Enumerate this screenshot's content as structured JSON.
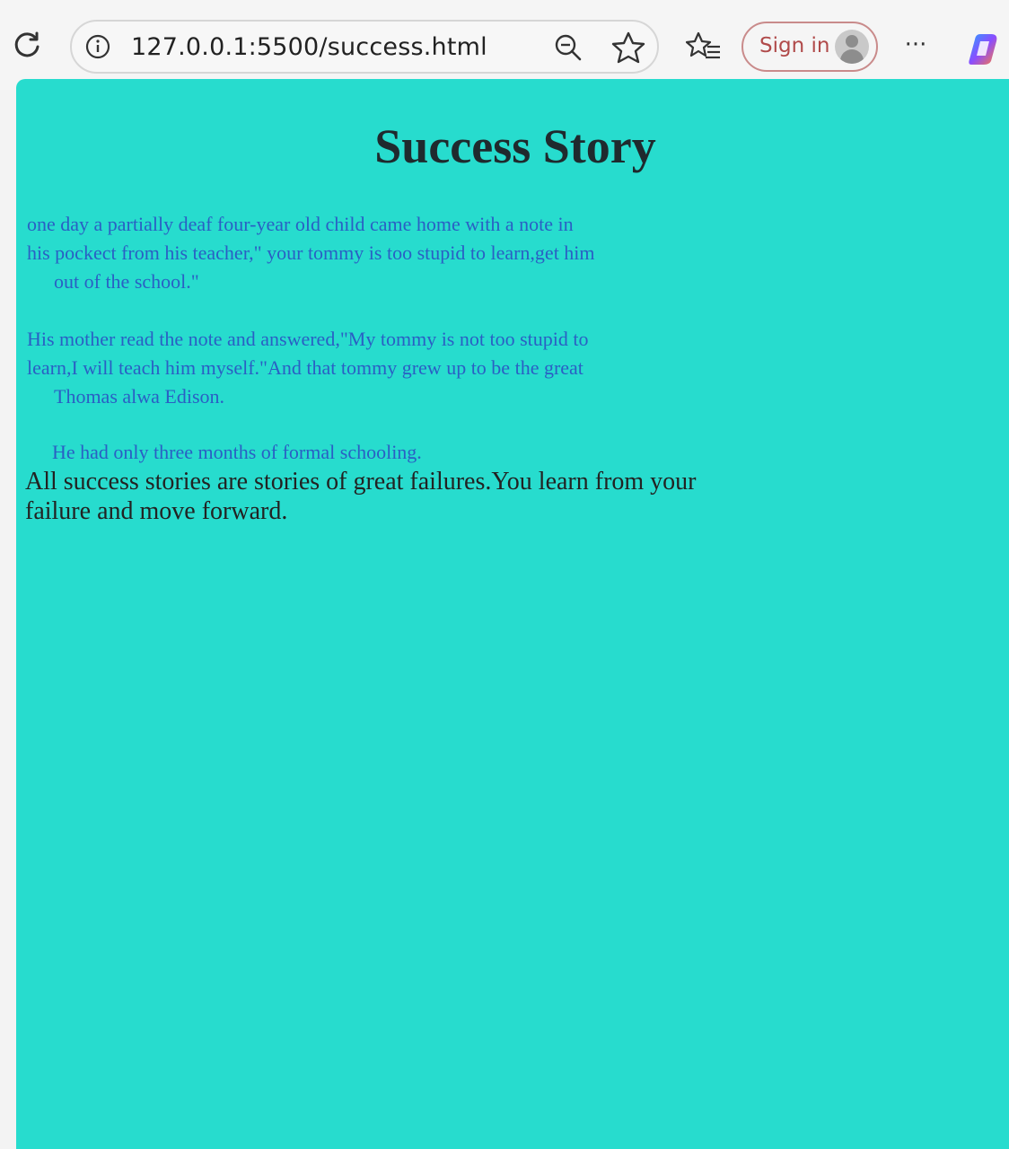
{
  "browser": {
    "url": "127.0.0.1:5500/success.html",
    "signin_label": "Sign in",
    "icons": {
      "reload": "reload-icon",
      "info": "info-icon",
      "zoom": "zoom-out-icon",
      "favorite": "star-icon",
      "favorites_list": "favorites-icon",
      "profile": "avatar",
      "more": "more-icon",
      "copilot": "copilot-icon"
    },
    "more_glyph": "···"
  },
  "page": {
    "background": "#27dcce",
    "title": "Success Story",
    "paragraphs": [
      {
        "line1": "one day a partially deaf four-year old child came home with a note in",
        "line2": "his pockect from his teacher,\" your tommy is too stupid to learn,get him",
        "line3": "out of the school.\""
      },
      {
        "line1": "His mother read the note and answered,\"My tommy is not too stupid to",
        "line2": "learn,I will teach him myself.\"And that tommy grew up to be the great",
        "line3": "Thomas alwa Edison."
      }
    ],
    "schooling": "He had only three months of formal schooling.",
    "closing": "All success stories are stories of great failures.You learn from your failure and move forward.",
    "text_color": "#2a5fc4"
  }
}
